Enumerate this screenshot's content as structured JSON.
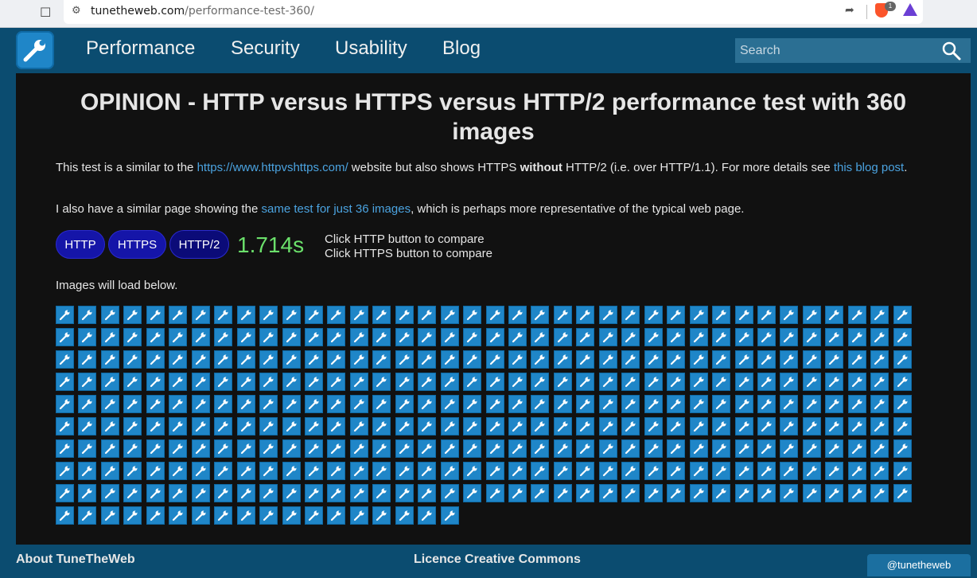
{
  "browser": {
    "url_host": "tunetheweb.com",
    "url_path": "/performance-test-360/",
    "shield_count": "1",
    "icons": [
      "bookmark-icon",
      "site-info-icon",
      "share-icon",
      "brave-shield-icon",
      "brave-rewards-icon"
    ]
  },
  "nav": {
    "items": [
      {
        "label": "Performance"
      },
      {
        "label": "Security"
      },
      {
        "label": "Usability"
      },
      {
        "label": "Blog"
      }
    ],
    "search_placeholder": "Search"
  },
  "main": {
    "title": "OPINION - HTTP versus HTTPS versus HTTP/2 performance test with 360 images",
    "intro_1": "This test is a similar to the ",
    "intro_link": "https://www.httpvshttps.com/",
    "intro_2": " website but also shows HTTPS ",
    "intro_bold": "without",
    "intro_3": " HTTP/2 (i.e. over HTTP/1.1). For more details see ",
    "intro_link2": "this blog post",
    "intro_4": ".",
    "similar_1": "I also have a similar page showing the ",
    "similar_link": "same test for just 36 images",
    "similar_2": ", which is perhaps more representative of the typical web page.",
    "buttons": {
      "http": "HTTP",
      "https": "HTTPS",
      "http2": "HTTP/2"
    },
    "timer": "1.714s",
    "compare_1": "Click HTTP button to compare",
    "compare_2": "Click HTTPS button to compare",
    "images_label": "Images will load below.",
    "images_total": 360,
    "images_per_row": 38
  },
  "footer": {
    "about": "About TuneTheWeb",
    "licence": "Licence Creative Commons",
    "twitter": "@tunetheweb"
  },
  "colors": {
    "page_bg": "#0b4c70",
    "panel_bg": "#111111",
    "link": "#4ba3e0",
    "timer": "#6be06b",
    "button": "#1515a8",
    "tile": "#1f86c8"
  }
}
